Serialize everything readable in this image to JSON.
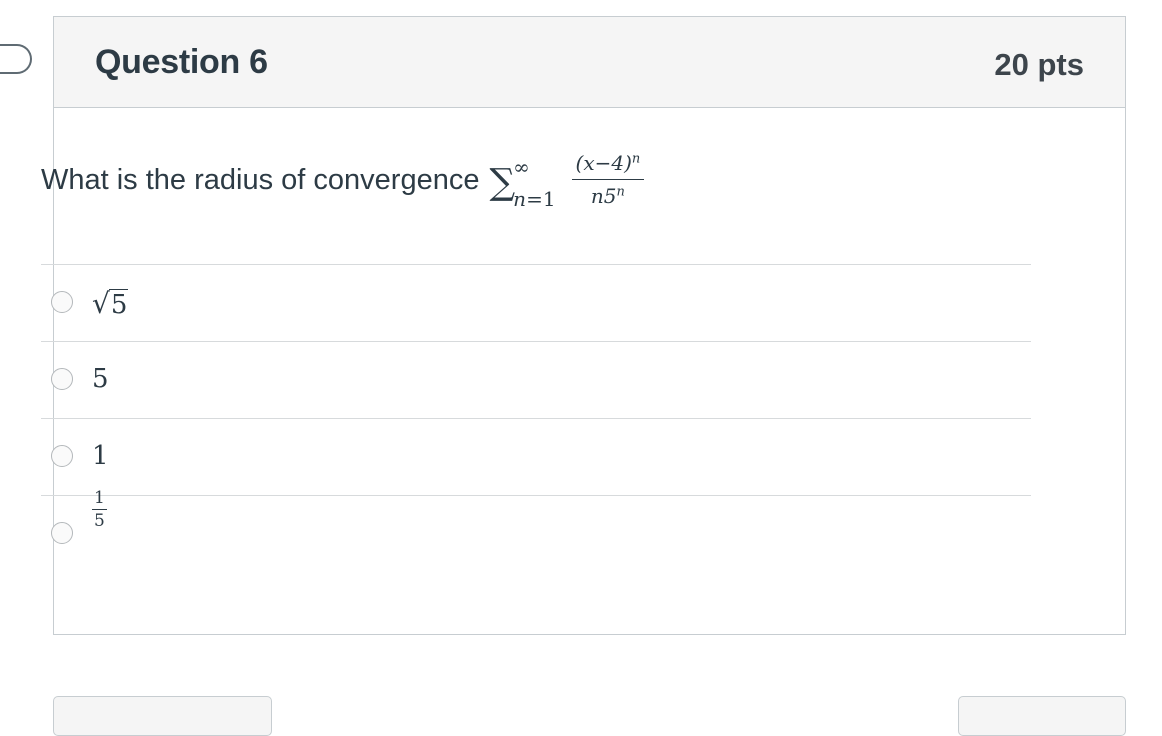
{
  "question": {
    "title": "Question 6",
    "points": "20 pts",
    "prompt": "What is the radius of convergence",
    "math": {
      "sum_upper": "∞",
      "sum_lower_var": "n",
      "sum_lower_rest": "=1",
      "numerator": "(x−4)",
      "numerator_exp": "n",
      "denominator": "n5",
      "denominator_exp": "n"
    }
  },
  "answers": [
    {
      "radical": "√",
      "value": "5"
    },
    {
      "value": "5"
    },
    {
      "value": "1"
    },
    {
      "numerator": "1",
      "denominator": "5"
    }
  ]
}
